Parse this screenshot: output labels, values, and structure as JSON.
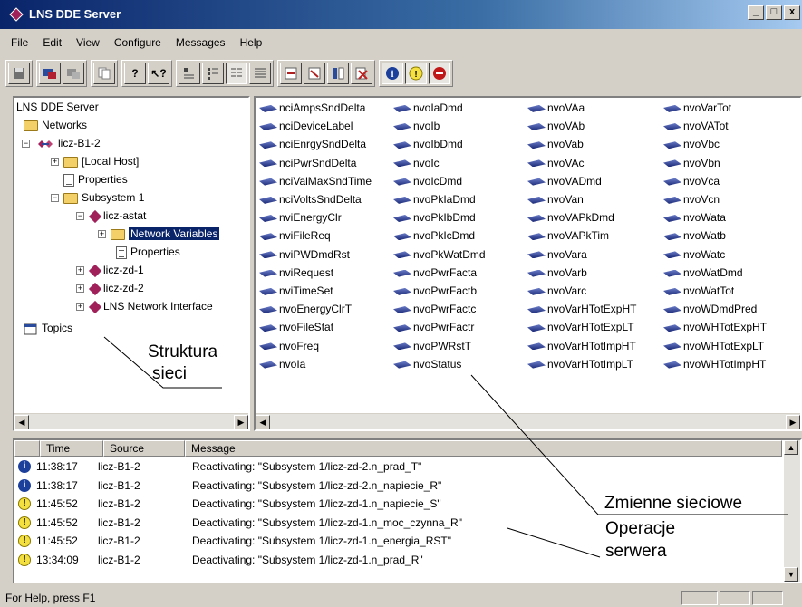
{
  "window": {
    "title": "LNS DDE Server",
    "minimize": "_",
    "maximize": "□",
    "close": "x"
  },
  "menu": [
    "File",
    "Edit",
    "View",
    "Configure",
    "Messages",
    "Help"
  ],
  "toolbar": {
    "groups": [
      [
        "disk-icon",
        "network-icon",
        "disabled-icon"
      ],
      [
        "copy-icon"
      ],
      [
        "help-icon",
        "context-help-icon"
      ],
      [
        "large-icons-view",
        "small-icons-view",
        "list-view",
        "details-view"
      ],
      [
        "add-icon",
        "remove-icon",
        "split-icon",
        "delete-icon"
      ],
      [
        "info-filter-icon",
        "warning-filter-icon",
        "error-filter-icon"
      ]
    ]
  },
  "tree": {
    "root": "LNS DDE Server",
    "networks": "Networks",
    "licz_b1_2": "licz-B1-2",
    "local_host": "[Local Host]",
    "properties": "Properties",
    "subsystem": "Subsystem 1",
    "licz_astat": "licz-astat",
    "network_variables": "Network Variables",
    "astat_properties": "Properties",
    "licz_zd_1": "licz-zd-1",
    "licz_zd_2": "licz-zd-2",
    "lns_ni": "LNS Network Interface",
    "topics": "Topics"
  },
  "variables": [
    [
      "nciAmpsSndDelta",
      "nciDeviceLabel",
      "nciEnrgySndDelta",
      "nciPwrSndDelta",
      "nciValMaxSndTime",
      "nciVoltsSndDelta",
      "nviEnergyClr",
      "nviFileReq",
      "nviPWDmdRst",
      "nviRequest",
      "nviTimeSet",
      "nvoEnergyClrT",
      "nvoFileStat",
      "nvoFreq",
      "nvoIa"
    ],
    [
      "nvoIaDmd",
      "nvoIb",
      "nvoIbDmd",
      "nvoIc",
      "nvoIcDmd",
      "nvoPkIaDmd",
      "nvoPkIbDmd",
      "nvoPkIcDmd",
      "nvoPkWatDmd",
      "nvoPwrFacta",
      "nvoPwrFactb",
      "nvoPwrFactc",
      "nvoPwrFactr",
      "nvoPWRstT",
      "nvoStatus"
    ],
    [
      "nvoVAa",
      "nvoVAb",
      "nvoVab",
      "nvoVAc",
      "nvoVADmd",
      "nvoVan",
      "nvoVAPkDmd",
      "nvoVAPkTim",
      "nvoVara",
      "nvoVarb",
      "nvoVarc",
      "nvoVarHTotExpHT",
      "nvoVarHTotExpLT",
      "nvoVarHTotImpHT",
      "nvoVarHTotImpLT"
    ],
    [
      "nvoVarTot",
      "nvoVATot",
      "nvoVbc",
      "nvoVbn",
      "nvoVca",
      "nvoVcn",
      "nvoWata",
      "nvoWatb",
      "nvoWatc",
      "nvoWatDmd",
      "nvoWatTot",
      "nvoWDmdPred",
      "nvoWHTotExpHT",
      "nvoWHTotExpLT",
      "nvoWHTotImpHT"
    ]
  ],
  "messages": {
    "headers": {
      "time": "Time",
      "source": "Source",
      "message": "Message"
    },
    "rows": [
      {
        "type": "info",
        "time": "11:38:17",
        "source": "licz-B1-2",
        "message": "Reactivating: \"Subsystem 1/licz-zd-2.n_prad_T\""
      },
      {
        "type": "info",
        "time": "11:38:17",
        "source": "licz-B1-2",
        "message": "Reactivating: \"Subsystem 1/licz-zd-2.n_napiecie_R\""
      },
      {
        "type": "warning",
        "time": "11:45:52",
        "source": "licz-B1-2",
        "message": "Deactivating: \"Subsystem 1/licz-zd-1.n_napiecie_S\""
      },
      {
        "type": "warning",
        "time": "11:45:52",
        "source": "licz-B1-2",
        "message": "Deactivating: \"Subsystem 1/licz-zd-1.n_moc_czynna_R\""
      },
      {
        "type": "warning",
        "time": "11:45:52",
        "source": "licz-B1-2",
        "message": "Deactivating: \"Subsystem 1/licz-zd-1.n_energia_RST\""
      },
      {
        "type": "warning",
        "time": "13:34:09",
        "source": "licz-B1-2",
        "message": "Deactivating: \"Subsystem 1/licz-zd-1.n_prad_R\""
      }
    ]
  },
  "status": {
    "text": "For Help, press F1"
  },
  "annotations": {
    "struktura_1": "Struktura",
    "struktura_2": "sieci",
    "zmienne": "Zmienne sieciowe",
    "operacje_1": "Operacje",
    "operacje_2": "serwera"
  },
  "colors": {
    "title_bar": "#0a246a",
    "selection": "#0a246a",
    "info": "#1c3f9c",
    "warning": "#f4e040"
  }
}
